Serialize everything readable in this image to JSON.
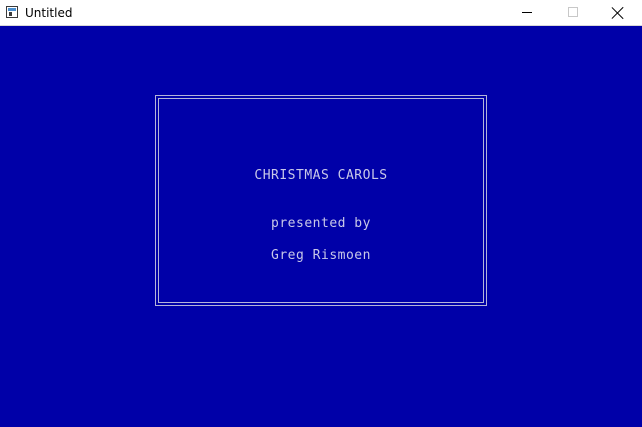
{
  "window": {
    "title": "Untitled",
    "icon": "application-icon",
    "controls": {
      "minimize": "minimize-icon",
      "maximize": "maximize-icon",
      "close": "close-icon"
    }
  },
  "screen": {
    "background_color": "#0000a8",
    "text_color": "#c8c8e8",
    "border_color": "#b4b4d8",
    "lines": {
      "title": "CHRISTMAS CAROLS",
      "presented": "presented by",
      "author": "Greg Rismoen"
    }
  }
}
